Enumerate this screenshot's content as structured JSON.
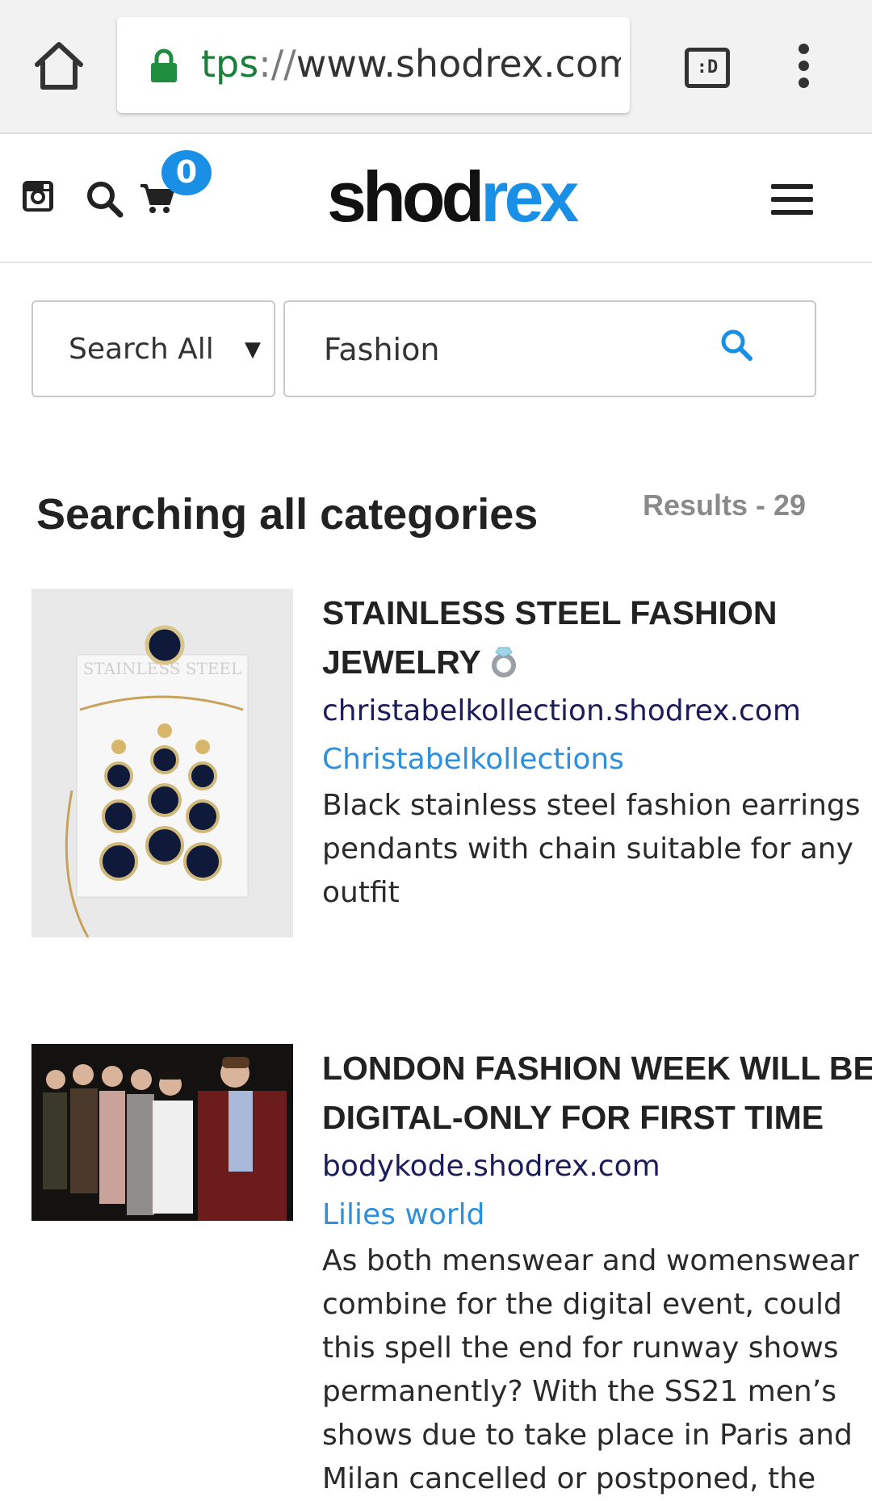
{
  "browser": {
    "url_scheme_partial": "tps",
    "url_separator": "://",
    "url_host": "www.shodrex.com",
    "tabs_label": ":D"
  },
  "site": {
    "logo_part1": "shod",
    "logo_part2": "rex",
    "cart_count": "0",
    "brand_color": "#1a8fe6"
  },
  "search": {
    "category_selected": "Search All",
    "query": "Fashion"
  },
  "heading": {
    "title": "Searching all categories",
    "results_label": "Results - 29"
  },
  "results": [
    {
      "title": "STAINLESS STEEL FASHION JEWELRY",
      "title_emoji": "ring-icon",
      "domain": "christabelkollection.shodrex.com",
      "store": "Christabelkollections",
      "description": "Black stainless steel fashion earrings pendants with chain suitable for any outfit",
      "image_text": "STAINLESS STEEL"
    },
    {
      "title": "LONDON FASHION WEEK WILL BE DIGITAL-ONLY FOR FIRST TIME",
      "domain": "bodykode.shodrex.com",
      "store": "Lilies world",
      "description": "As both menswear and womenswear combine for the digital event, could this spell the end for runway shows permanently? With the SS21 men’s shows due to take place in Paris and Milan cancelled or postponed, the"
    }
  ]
}
